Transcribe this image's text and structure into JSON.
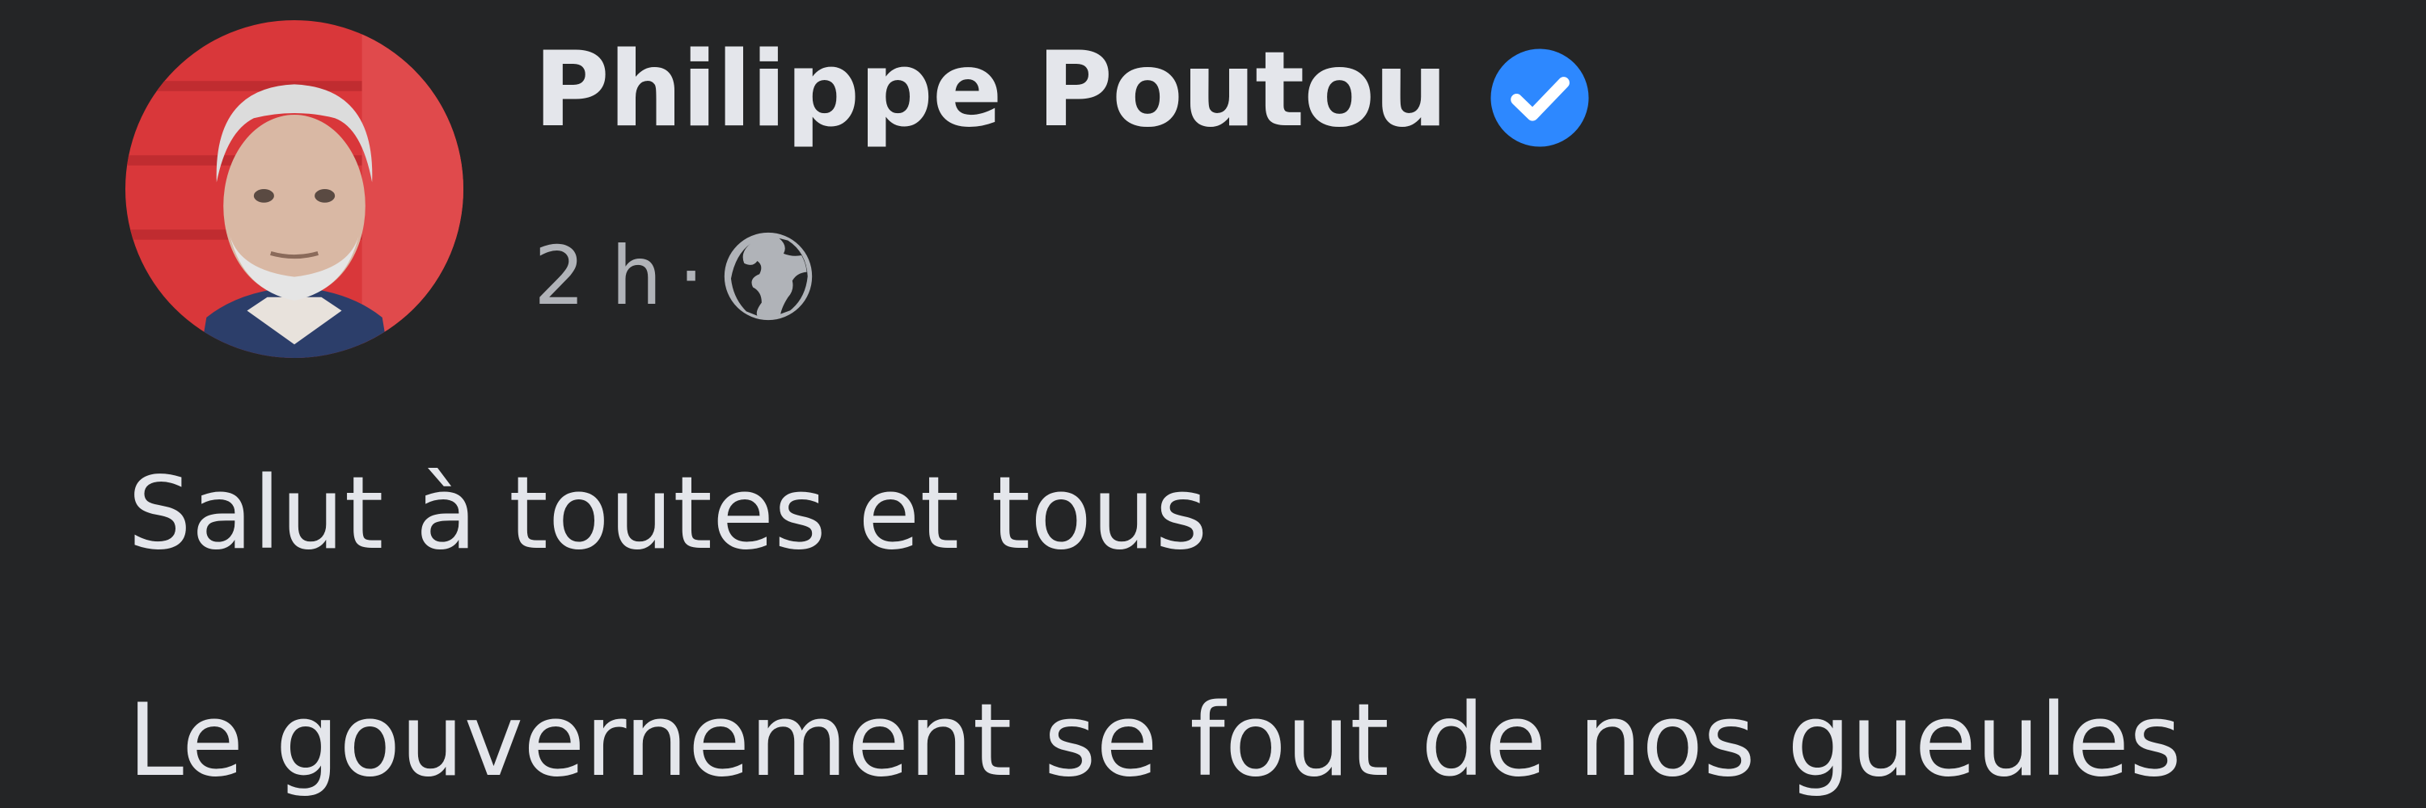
{
  "post": {
    "author": {
      "name": "Philippe Poutou",
      "verified_icon": "verified-badge-icon",
      "avatar_icon": "profile-photo"
    },
    "meta": {
      "time": "2 h",
      "separator": "·",
      "audience_icon": "globe-icon"
    },
    "text_lines": [
      "Salut à toutes et tous",
      "Le gouvernement se fout de nos gueules"
    ]
  },
  "colors": {
    "background": "#242526",
    "primary_text": "#e4e6eb",
    "secondary_text": "#b0b3b8",
    "verified_blue": "#2d88ff",
    "avatar_background": "#d9373a"
  }
}
